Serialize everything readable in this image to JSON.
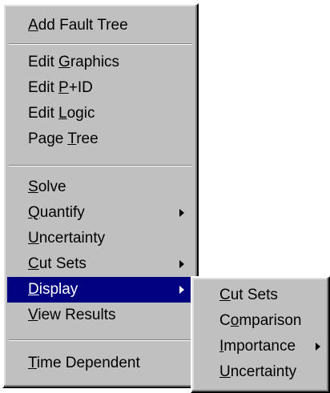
{
  "main_menu": {
    "items": [
      {
        "pre": "",
        "key": "A",
        "post": "dd Fault Tree"
      },
      {
        "pre": "Edit ",
        "key": "G",
        "post": "raphics"
      },
      {
        "pre": "Edit ",
        "key": "P",
        "post": "+ID"
      },
      {
        "pre": "Edit ",
        "key": "L",
        "post": "ogic"
      },
      {
        "pre": "Page ",
        "key": "T",
        "post": "ree"
      },
      {
        "pre": "",
        "key": "S",
        "post": "olve"
      },
      {
        "pre": "",
        "key": "Q",
        "post": "uantify",
        "submenu_arrow": "right-triangle-icon"
      },
      {
        "pre": "",
        "key": "U",
        "post": "ncertainty"
      },
      {
        "pre": "",
        "key": "C",
        "post": "ut Sets",
        "submenu_arrow": "right-triangle-icon"
      },
      {
        "pre": "",
        "key": "D",
        "post": "isplay",
        "submenu_arrow": "right-triangle-icon",
        "selected": true
      },
      {
        "pre": "",
        "key": "V",
        "post": "iew Results"
      },
      {
        "pre": "",
        "key": "T",
        "post": "ime Dependent"
      }
    ]
  },
  "display_submenu": {
    "items": [
      {
        "pre": "",
        "key": "C",
        "post": "ut Sets"
      },
      {
        "pre": "C",
        "key": "o",
        "post": "mparison"
      },
      {
        "pre": "",
        "key": "I",
        "post": "mportance",
        "submenu_arrow": "right-triangle-icon"
      },
      {
        "pre": "",
        "key": "U",
        "post": "ncertainty"
      }
    ]
  },
  "colors": {
    "menu_face": "#c0c0c0",
    "highlight": "#000080",
    "highlight_text": "#ffffff",
    "text": "#000000",
    "separator_dark": "#808080",
    "separator_light": "#ffffff"
  }
}
